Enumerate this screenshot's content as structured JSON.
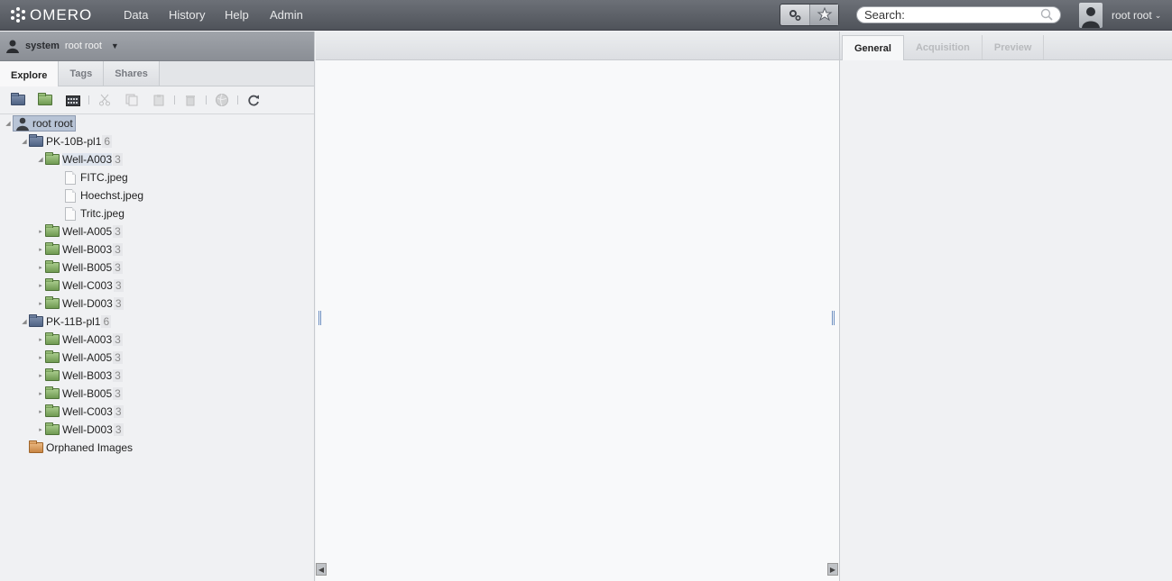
{
  "topbar": {
    "logo": "OMERO",
    "nav": [
      "Data",
      "History",
      "Help",
      "Admin"
    ],
    "search_placeholder": "Search:",
    "user": "root root"
  },
  "left": {
    "group": "system",
    "user": "root root",
    "tabs": [
      "Explore",
      "Tags",
      "Shares"
    ],
    "tree": {
      "root": "root root",
      "plates": [
        {
          "name": "PK-10B-pl1",
          "count": "6",
          "wells": [
            {
              "name": "Well-A003",
              "count": "3",
              "files": [
                "FITC.jpeg",
                "Hoechst.jpeg",
                "Tritc.jpeg"
              ]
            },
            {
              "name": "Well-A005",
              "count": "3"
            },
            {
              "name": "Well-B003",
              "count": "3"
            },
            {
              "name": "Well-B005",
              "count": "3"
            },
            {
              "name": "Well-C003",
              "count": "3"
            },
            {
              "name": "Well-D003",
              "count": "3"
            }
          ]
        },
        {
          "name": "PK-11B-pl1",
          "count": "6",
          "wells": [
            {
              "name": "Well-A003",
              "count": "3"
            },
            {
              "name": "Well-A005",
              "count": "3"
            },
            {
              "name": "Well-B003",
              "count": "3"
            },
            {
              "name": "Well-B005",
              "count": "3"
            },
            {
              "name": "Well-C003",
              "count": "3"
            },
            {
              "name": "Well-D003",
              "count": "3"
            }
          ]
        }
      ],
      "orphaned": "Orphaned Images"
    }
  },
  "right": {
    "tabs": [
      "General",
      "Acquisition",
      "Preview"
    ]
  }
}
